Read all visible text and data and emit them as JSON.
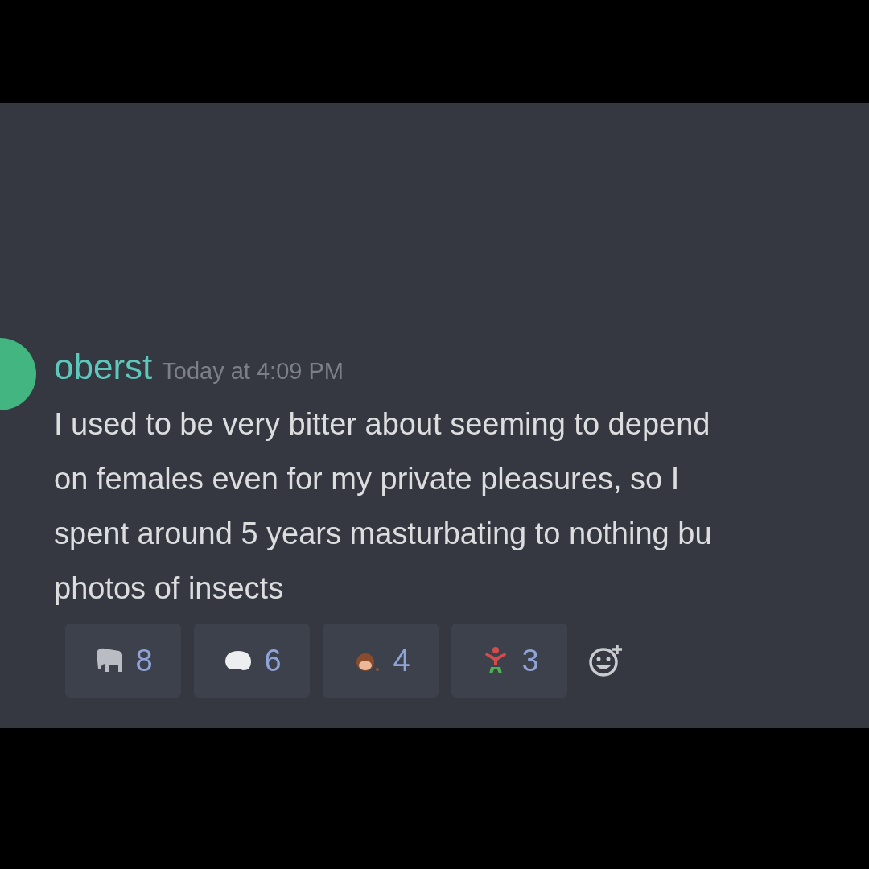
{
  "message": {
    "username": "oberst",
    "timestamp": "Today at 4:09 PM",
    "lines": [
      "I used to be very bitter about seeming to depend",
      "on females even for my private pleasures, so I",
      "spent around 5 years masturbating to nothing bu",
      "photos of insects"
    ]
  },
  "reactions": [
    {
      "kind": "elephant",
      "count": "8"
    },
    {
      "kind": "blob",
      "count": "6"
    },
    {
      "kind": "head",
      "count": "4"
    },
    {
      "kind": "figure",
      "count": "3"
    }
  ]
}
